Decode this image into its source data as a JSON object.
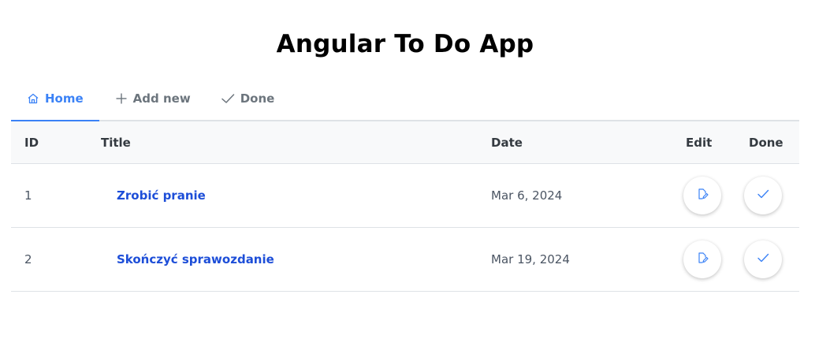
{
  "app": {
    "title": "Angular To Do App"
  },
  "tabs": [
    {
      "label": "Home",
      "icon": "home-icon",
      "active": true
    },
    {
      "label": "Add new",
      "icon": "plus-icon",
      "active": false
    },
    {
      "label": "Done",
      "icon": "check-icon",
      "active": false
    }
  ],
  "table": {
    "headers": {
      "id": "ID",
      "title": "Title",
      "date": "Date",
      "edit": "Edit",
      "done": "Done"
    },
    "rows": [
      {
        "id": "1",
        "title": "Zrobić pranie",
        "date": "Mar 6, 2024"
      },
      {
        "id": "2",
        "title": "Skończyć sprawozdanie",
        "date": "Mar 19, 2024"
      }
    ]
  },
  "colors": {
    "accent": "#3b82f6",
    "link": "#1d4ed8",
    "header_bg": "#f8f9fa",
    "border": "#dee2e6"
  }
}
